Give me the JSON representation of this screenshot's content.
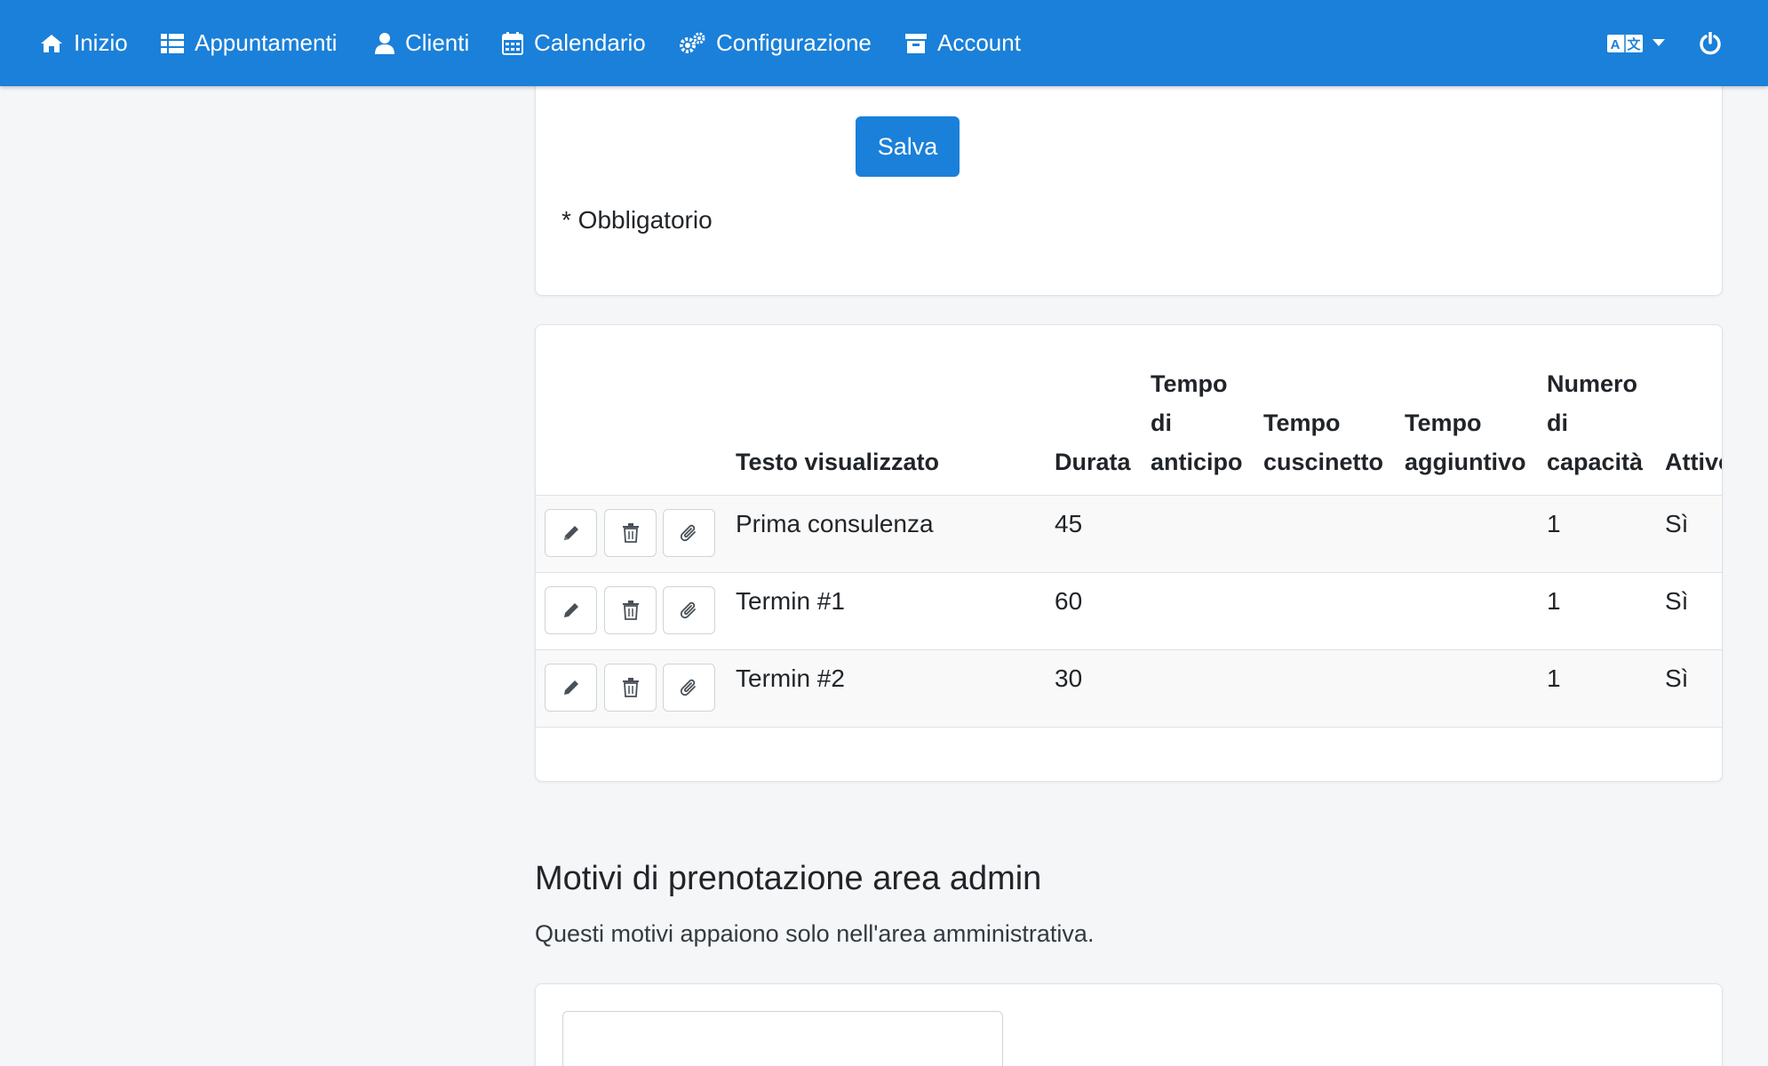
{
  "nav": {
    "items": [
      {
        "label": "Inizio",
        "icon": "home-icon"
      },
      {
        "label": "Appuntamenti",
        "icon": "list-icon"
      },
      {
        "label": "Clienti",
        "icon": "user-icon"
      },
      {
        "label": "Calendario",
        "icon": "calendar-icon"
      },
      {
        "label": "Configurazione",
        "icon": "gears-icon"
      },
      {
        "label": "Account",
        "icon": "archive-icon"
      }
    ],
    "right": [
      {
        "icon": "language-icon"
      },
      {
        "icon": "power-icon"
      }
    ]
  },
  "form": {
    "save_label": "Salva",
    "required_note": "* Obbligatorio"
  },
  "services_table": {
    "headers": {
      "name": "Testo visualizzato",
      "duration": "Durata",
      "lead_time": [
        "Tempo",
        "di",
        "anticipo"
      ],
      "buffer": [
        "Tempo",
        "cuscinetto"
      ],
      "extra": [
        "Tempo",
        "aggiuntivo"
      ],
      "capacity": [
        "Numero",
        "di",
        "capacità"
      ],
      "active": "Attivo"
    },
    "rows": [
      {
        "name": "Prima consulenza",
        "duration": "45",
        "lead_time": "",
        "buffer": "",
        "extra": "",
        "capacity": "1",
        "active": "Sì"
      },
      {
        "name": "Termin #1",
        "duration": "60",
        "lead_time": "",
        "buffer": "",
        "extra": "",
        "capacity": "1",
        "active": "Sì"
      },
      {
        "name": "Termin #2",
        "duration": "30",
        "lead_time": "",
        "buffer": "",
        "extra": "",
        "capacity": "1",
        "active": "Sì"
      }
    ],
    "row_actions": [
      {
        "icon": "pencil-icon"
      },
      {
        "icon": "trash-icon"
      },
      {
        "icon": "paperclip-icon"
      }
    ]
  },
  "admin_section": {
    "title": "Motivi di prenotazione area admin",
    "subtitle": "Questi motivi appaiono solo nell'area amministrativa."
  },
  "colors": {
    "primary": "#1a80d9",
    "background": "#f4f6f8",
    "card": "#ffffff",
    "border": "#dee2e6"
  }
}
